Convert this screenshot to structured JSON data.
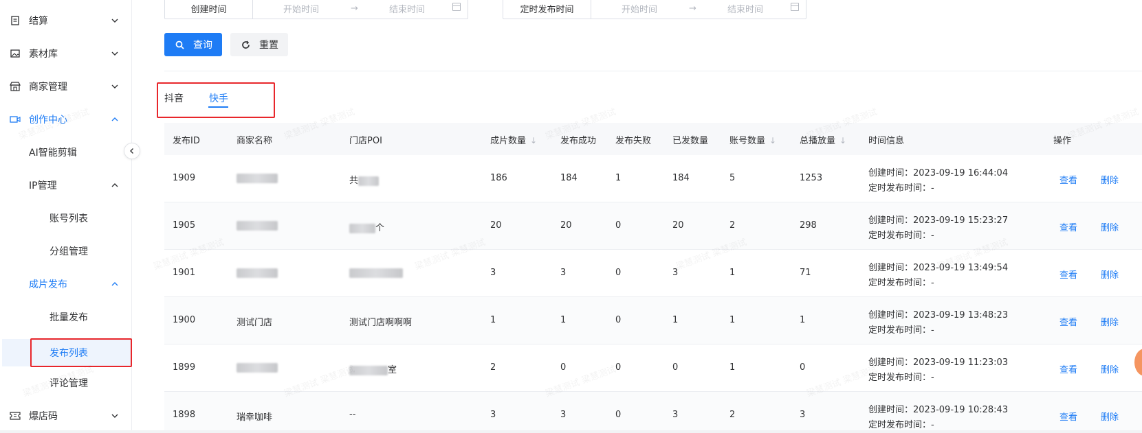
{
  "sidebar": {
    "items": [
      {
        "label": "结算",
        "icon": "document-icon",
        "expanded": false
      },
      {
        "label": "素材库",
        "icon": "image-icon",
        "expanded": false
      },
      {
        "label": "商家管理",
        "icon": "store-icon",
        "expanded": false
      },
      {
        "label": "创作中心",
        "icon": "video-icon",
        "expanded": true
      },
      {
        "label": "AI智能剪辑"
      },
      {
        "label": "IP管理",
        "expanded": true
      },
      {
        "label": "账号列表"
      },
      {
        "label": "分组管理"
      },
      {
        "label": "成片发布",
        "expanded": true
      },
      {
        "label": "批量发布"
      },
      {
        "label": "发布列表",
        "selected": true
      },
      {
        "label": "评论管理"
      },
      {
        "label": "爆店码",
        "icon": "ticket-icon",
        "expanded": false
      }
    ]
  },
  "filters": {
    "created": {
      "label": "创建时间",
      "start_placeholder": "开始时间",
      "end_placeholder": "结束时间"
    },
    "scheduled": {
      "label": "定时发布时间",
      "start_placeholder": "开始时间",
      "end_placeholder": "结束时间"
    },
    "arrow": "→"
  },
  "buttons": {
    "query": "查询",
    "reset": "重置"
  },
  "tabs": [
    {
      "label": "抖音",
      "active": false
    },
    {
      "label": "快手",
      "active": true
    }
  ],
  "table": {
    "columns": [
      "发布ID",
      "商家名称",
      "门店POI",
      "成片数量",
      "发布成功",
      "发布失败",
      "已发数量",
      "账号数量",
      "总播放量",
      "时间信息",
      "操作"
    ],
    "sort_arrow": "↓",
    "created_prefix": "创建时间：",
    "scheduled_prefix": "定时发布时间：",
    "actions": {
      "view": "查看",
      "delete": "删除"
    },
    "rows": [
      {
        "id": "1909",
        "merchant": "",
        "poi": "共",
        "clips": "186",
        "success": "184",
        "failed": "1",
        "sent": "184",
        "accounts": "5",
        "plays": "1253",
        "created": "2023-09-19 16:44:04",
        "scheduled": "-"
      },
      {
        "id": "1905",
        "merchant": "",
        "poi": "个",
        "clips": "20",
        "success": "20",
        "failed": "0",
        "sent": "20",
        "accounts": "2",
        "plays": "298",
        "created": "2023-09-19 15:23:27",
        "scheduled": "-"
      },
      {
        "id": "1901",
        "merchant": "",
        "poi": "",
        "clips": "3",
        "success": "3",
        "failed": "0",
        "sent": "3",
        "accounts": "1",
        "plays": "71",
        "created": "2023-09-19 13:49:54",
        "scheduled": "-"
      },
      {
        "id": "1900",
        "merchant": "测试门店",
        "poi": "测试门店啊啊啊",
        "clips": "1",
        "success": "1",
        "failed": "0",
        "sent": "1",
        "accounts": "1",
        "plays": "1",
        "created": "2023-09-19 13:48:23",
        "scheduled": "-"
      },
      {
        "id": "1899",
        "merchant": "",
        "poi": "室",
        "clips": "2",
        "success": "0",
        "failed": "0",
        "sent": "0",
        "accounts": "1",
        "plays": "0",
        "created": "2023-09-19 11:23:03",
        "scheduled": "-"
      },
      {
        "id": "1898",
        "merchant": "瑞幸咖啡",
        "poi": "--",
        "clips": "3",
        "success": "3",
        "failed": "0",
        "sent": "3",
        "accounts": "2",
        "plays": "3",
        "created": "2023-09-19 10:28:43",
        "scheduled": "-"
      }
    ]
  },
  "watermark": "梁慧测试 梁慧测试",
  "colors": {
    "primary": "#1e7cf5",
    "highlight_border": "#e8262b",
    "header_bg": "#f7f8fa"
  }
}
